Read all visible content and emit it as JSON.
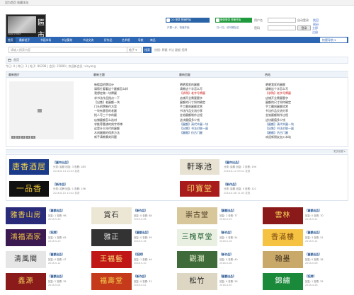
{
  "topbar": {
    "text": "设为首页  收藏本站"
  },
  "logo": {
    "mark": "匾市",
    "sub": "SIGN STORE"
  },
  "header": {
    "buttons": [
      {
        "label": "QQ 登录 快速开始",
        "color": "#2a64a6",
        "icon": "qq-icon"
      },
      {
        "label": "微信登录 快速开始",
        "color": "#1f9a3c",
        "icon": "wechat-icon"
      }
    ],
    "qq_sub": "只需一步，快速开始",
    "wx_sub": "扫一扫，访问微社区",
    "login": {
      "user_label": "用户名",
      "pass_label": "密码",
      "auto_label": "自动登录",
      "forgot_label": "找回密码",
      "login_button": "登录",
      "register_link": "立即注册"
    }
  },
  "nav": {
    "items": [
      "首页",
      "最新帖子",
      "书画市场",
      "书法篆刻",
      "书法交流",
      "好作品",
      "艺术馆",
      "导航",
      "商品"
    ],
    "active_index": 0,
    "quick": "快捷导航 ▾"
  },
  "search": {
    "placeholder": "请输入搜索内容",
    "type": "帖子 ▾",
    "button": "搜索",
    "hot": "热搜: 牌匾 书法 匾额 招牌"
  },
  "breadcrumb": "首页",
  "stats": "今日: 0 | 昨日: 3 | 帖子: 86298 | 会员: 25890 | 欢迎新会员: xinyang",
  "panels": {
    "headers": [
      "最新图片",
      "最新主题",
      "最新回复",
      "热帖"
    ],
    "slide_dots": [
      "1",
      "2",
      "3",
      "4",
      "5"
    ],
    "lists": [
      [
        "新楼盘招牌设计",
        "请帮忙看看这个匾额怎么样",
        "我想定做一块牌匾",
        "求书法作品指点一下",
        "【出售】老匾额一块",
        "门头招牌制作方案",
        "一块有意思的老匾",
        "找人写三个字的匾",
        "店铺匾额怎么选材",
        "求推荐靠谱的刻字师傅",
        "这是什么年代的匾额",
        "木刻匾额的保养方法",
        "新手请教篆刻问题"
      ],
      [
        "晒晒我家的匾额",
        "请教这个字怎么写",
        "【求购】老字号牌匾",
        "店铺开业需要题字",
        "匾额的尺寸如何确定",
        "手工雕刻匾额欣赏",
        "书法作品交流分享",
        "金箔匾额制作过程",
        "这块匾值多少钱",
        "【匾额】清代木匾一块",
        "【出售】书法对联一副",
        "【匾额】仿古门匾"
      ],
      [
        "晒晒我家的匾额",
        "请教这个字怎么写",
        "【求购】老字号牌匾",
        "店铺开业需要题字",
        "匾额的尺寸如何确定",
        "手工雕刻匾额欣赏",
        "书法作品交流分享",
        "金箔匾额制作过程",
        "这块匾值多少钱",
        "【匾额】清代木匾一块",
        "【出售】书法对联一副",
        "【匾额】仿古门匾",
        "欢迎新朋友加入本站"
      ]
    ]
  },
  "divider": "更多匾额 ▸",
  "featured": [
    {
      "thumb": "唐香酒居",
      "fg": "#f4d34a",
      "bg": "#1c3a8a",
      "title": "【匾市出品】",
      "meta": "分类: 匾额 回复: 3 查看: 283",
      "date": "2018-6-14 10:23 发表"
    },
    {
      "thumb": "軒琢池",
      "fg": "#222",
      "bg": "#e8e2d3",
      "title": "【匾市出品】",
      "meta": "分类: 匾额 回复: 2 查看: 190",
      "date": "2018-6-12 09:11 发表"
    },
    {
      "thumb": "一品香",
      "fg": "#f0c83a",
      "bg": "#111",
      "title": "【新作品】",
      "meta": "分类: 招牌 回复: 1 查看: 156",
      "date": "2018-6-10 15:42 发表"
    },
    {
      "thumb": "印寶堂",
      "fg": "#f3d36a",
      "bg": "#a81c1c",
      "title": "【新作品】",
      "meta": "分类: 匾额 回复: 0 查看: 121",
      "date": "2018-6-08 11:05 发表"
    }
  ],
  "gallery": [
    {
      "img": "雅香山房",
      "fg": "#f3cf4a",
      "bg": "#2a2a7a",
      "title": "【匾额出品】",
      "stat": "回复: 1 查看: 96",
      "date": "2018-5-30"
    },
    {
      "img": "賞石",
      "fg": "#333",
      "bg": "#ece6d4",
      "title": "【新作品】",
      "stat": "回复: 0 查看: 88",
      "date": "2018-5-28"
    },
    {
      "img": "崇古堂",
      "fg": "#4a3a22",
      "bg": "#d8c79a",
      "title": "【匾额出品】",
      "stat": "回复: 2 查看: 77",
      "date": "2018-5-25"
    },
    {
      "img": "雲林",
      "fg": "#f5d45a",
      "bg": "#8a1a1a",
      "title": "【匾额出品】",
      "stat": "回复: 0 查看: 70",
      "date": "2018-5-22"
    },
    {
      "img": "鴻福酒家",
      "fg": "#f0c040",
      "bg": "#3a1a50",
      "title": "【招牌】",
      "stat": "回复: 1 查看: 65",
      "date": "2018-5-20"
    },
    {
      "img": "雅正",
      "fg": "#ddd",
      "bg": "#333",
      "title": "【匾额出品】",
      "stat": "回复: 0 查看: 59",
      "date": "2018-5-18"
    },
    {
      "img": "三槐草堂",
      "fg": "#1f5e2c",
      "bg": "#e9f0e2",
      "title": "【新作品】",
      "stat": "回复: 0 查看: 54",
      "date": "2018-5-16"
    },
    {
      "img": "香滿樓",
      "fg": "#7a4a10",
      "bg": "#f5c242",
      "title": "【匾额出品】",
      "stat": "回复: 3 查看: 51",
      "date": "2018-5-14"
    },
    {
      "img": "清風閣",
      "fg": "#333",
      "bg": "#e6e6e6",
      "title": "【匾额出品】",
      "stat": "回复: 0 查看: 47",
      "date": "2018-5-12"
    },
    {
      "img": "王福藝",
      "fg": "#f5e07a",
      "bg": "#c01616",
      "title": "【招牌】",
      "stat": "回复: 1 查看: 44",
      "date": "2018-5-10"
    },
    {
      "img": "觀瀾",
      "fg": "#e9f2d2",
      "bg": "#3f6a3a",
      "title": "【新作品】",
      "stat": "回复: 0 查看: 40",
      "date": "2018-5-08"
    },
    {
      "img": "翰墨",
      "fg": "#3a2a1a",
      "bg": "#c9a96a",
      "title": "【匾额出品】",
      "stat": "回复: 0 查看: 38",
      "date": "2018-5-06"
    },
    {
      "img": "鑫源",
      "fg": "#f0d060",
      "bg": "#8b1a1a",
      "title": "【匾额出品】",
      "stat": "回复: 2 查看: 35",
      "date": "2018-5-04"
    },
    {
      "img": "福壽堂",
      "fg": "#f4d050",
      "bg": "#c43a1a",
      "title": "【新作品】",
      "stat": "回复: 0 查看: 31",
      "date": "2018-5-02"
    },
    {
      "img": "松竹",
      "fg": "#222",
      "bg": "#dcd6c2",
      "title": "【匾额出品】",
      "stat": "回复: 0 查看: 28",
      "date": "2018-4-30"
    },
    {
      "img": "錦繡",
      "fg": "#fff",
      "bg": "#1a8a3a",
      "title": "【招牌】",
      "stat": "回复: 1 查看: 25",
      "date": "2018-4-28"
    }
  ]
}
